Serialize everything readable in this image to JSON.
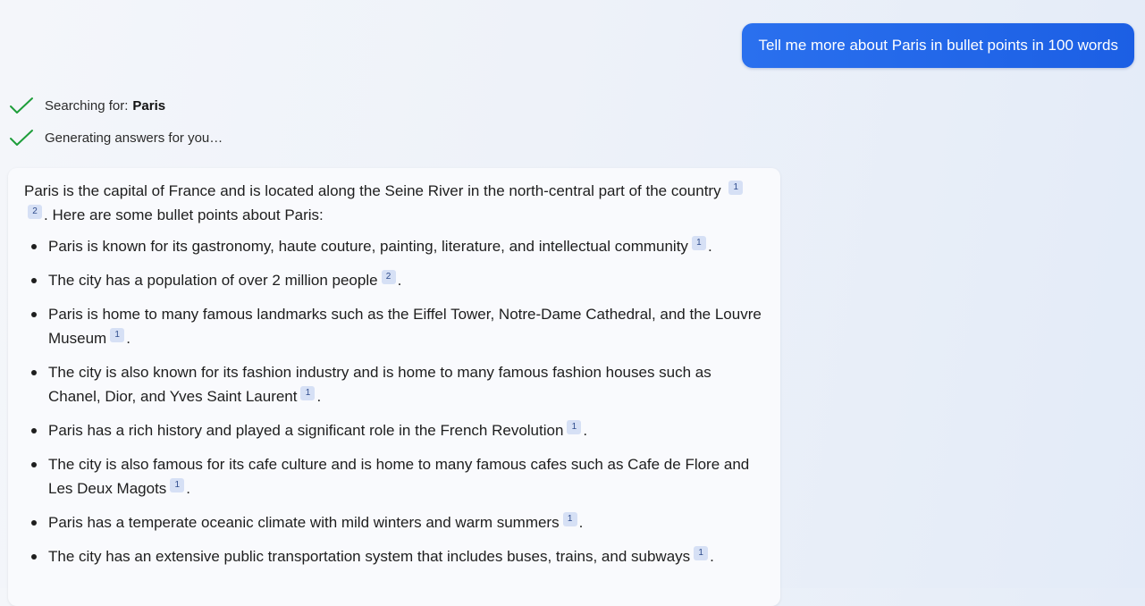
{
  "user_message": "Tell me more about Paris in bullet points in 100 words",
  "status": {
    "searching_label": "Searching for:",
    "searching_term": "Paris",
    "generating_label": "Generating answers for you…"
  },
  "answer": {
    "intro_text": "Paris is the capital of France and is located along the Seine River in the north-central part of the country",
    "intro_cite_1": "1",
    "intro_cite_2": "2",
    "intro_tail": ". Here are some bullet points about Paris:",
    "bullets": [
      {
        "text": "Paris is known for its gastronomy, haute couture, painting, literature, and intellectual community",
        "cite": "1"
      },
      {
        "text": "The city has a population of over 2 million people",
        "cite": "2"
      },
      {
        "text": "Paris is home to many famous landmarks such as the Eiffel Tower, Notre-Dame Cathedral, and the Louvre Museum",
        "cite": "1"
      },
      {
        "text": "The city is also known for its fashion industry and is home to many famous fashion houses such as Chanel, Dior, and Yves Saint Laurent",
        "cite": "1"
      },
      {
        "text": "Paris has a rich history and played a significant role in the French Revolution",
        "cite": "1"
      },
      {
        "text": "The city is also famous for its cafe culture and is home to many famous cafes such as Cafe de Flore and Les Deux Magots",
        "cite": "1"
      },
      {
        "text": "Paris has a temperate oceanic climate with mild winters and warm summers",
        "cite": "1"
      },
      {
        "text": "The city has an extensive public transportation system that includes buses, trains, and subways",
        "cite": "1"
      }
    ],
    "bullet_end": "."
  },
  "colors": {
    "user_bubble": "#1c5fe4",
    "check": "#1e9e3a",
    "citation_bg": "#d6e0f5",
    "citation_text": "#2e4b8c"
  },
  "icons": {
    "status_check": "check-icon"
  }
}
